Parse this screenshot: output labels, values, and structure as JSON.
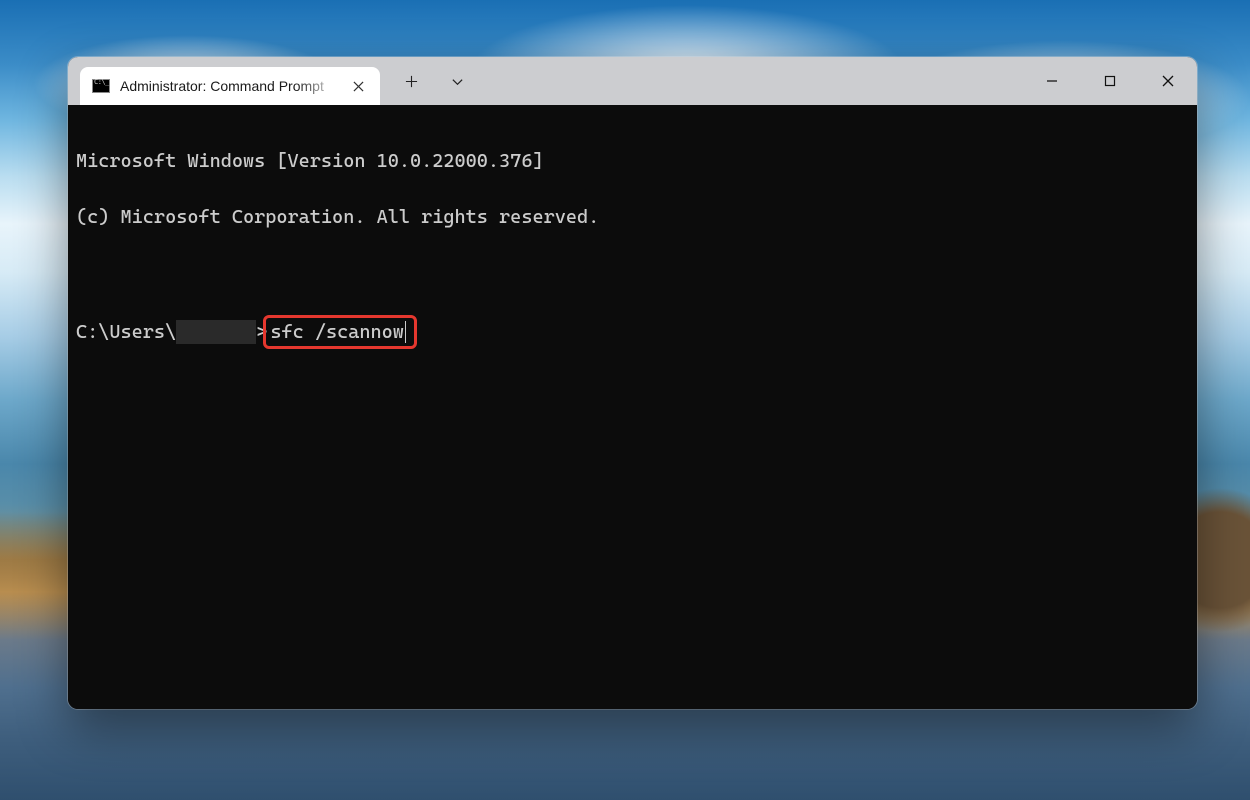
{
  "tab": {
    "title": "Administrator: Command Prompt"
  },
  "terminal": {
    "line1": "Microsoft Windows [Version 10.0.22000.376]",
    "line2": "(c) Microsoft Corporation. All rights reserved.",
    "prompt_prefix": "C:\\Users\\",
    "prompt_suffix": ">",
    "command": "sfc /scannow"
  },
  "highlight_color": "#e5372e"
}
